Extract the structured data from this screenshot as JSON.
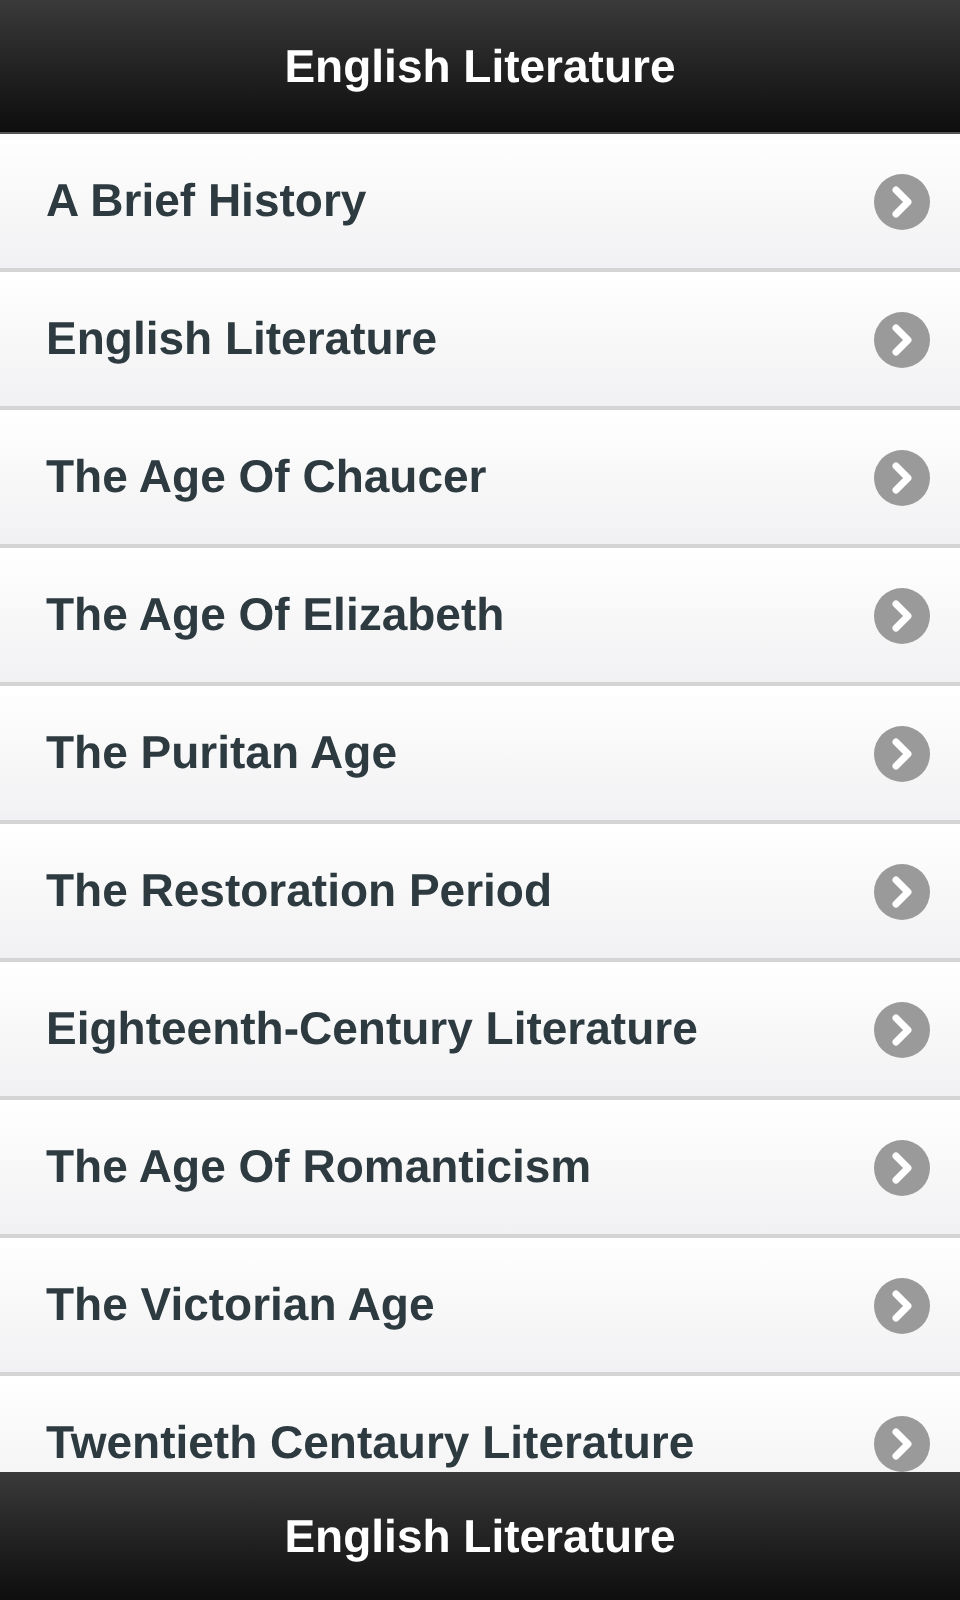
{
  "header": {
    "title": "English Literature"
  },
  "items": [
    {
      "label": "A Brief History"
    },
    {
      "label": "English Literature"
    },
    {
      "label": "The Age Of Chaucer"
    },
    {
      "label": "The Age Of Elizabeth"
    },
    {
      "label": "The Puritan Age"
    },
    {
      "label": "The Restoration Period"
    },
    {
      "label": "Eighteenth-Century Literature"
    },
    {
      "label": "The Age Of Romanticism"
    },
    {
      "label": "The Victorian Age"
    },
    {
      "label": "Twentieth Centaury Literature"
    }
  ],
  "footer": {
    "title": "English Literature"
  }
}
